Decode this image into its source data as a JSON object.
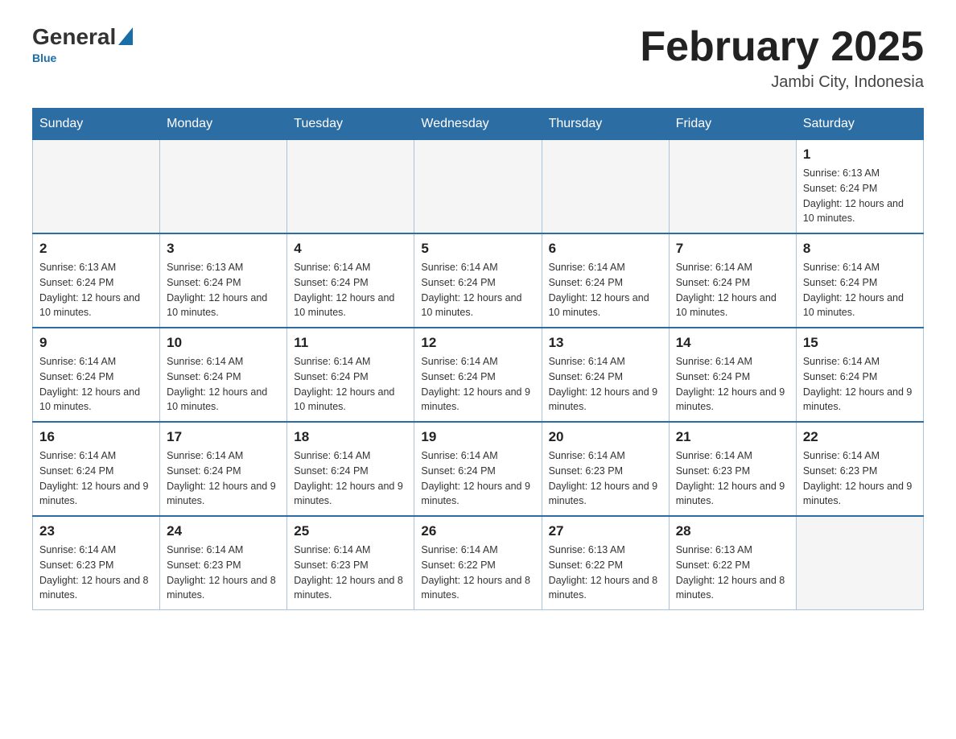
{
  "header": {
    "logo_general": "General",
    "logo_blue": "Blue",
    "title": "February 2025",
    "subtitle": "Jambi City, Indonesia"
  },
  "days_of_week": [
    "Sunday",
    "Monday",
    "Tuesday",
    "Wednesday",
    "Thursday",
    "Friday",
    "Saturday"
  ],
  "weeks": [
    [
      {
        "day": "",
        "empty": true
      },
      {
        "day": "",
        "empty": true
      },
      {
        "day": "",
        "empty": true
      },
      {
        "day": "",
        "empty": true
      },
      {
        "day": "",
        "empty": true
      },
      {
        "day": "",
        "empty": true
      },
      {
        "day": "1",
        "sunrise": "6:13 AM",
        "sunset": "6:24 PM",
        "daylight": "12 hours and 10 minutes."
      }
    ],
    [
      {
        "day": "2",
        "sunrise": "6:13 AM",
        "sunset": "6:24 PM",
        "daylight": "12 hours and 10 minutes."
      },
      {
        "day": "3",
        "sunrise": "6:13 AM",
        "sunset": "6:24 PM",
        "daylight": "12 hours and 10 minutes."
      },
      {
        "day": "4",
        "sunrise": "6:14 AM",
        "sunset": "6:24 PM",
        "daylight": "12 hours and 10 minutes."
      },
      {
        "day": "5",
        "sunrise": "6:14 AM",
        "sunset": "6:24 PM",
        "daylight": "12 hours and 10 minutes."
      },
      {
        "day": "6",
        "sunrise": "6:14 AM",
        "sunset": "6:24 PM",
        "daylight": "12 hours and 10 minutes."
      },
      {
        "day": "7",
        "sunrise": "6:14 AM",
        "sunset": "6:24 PM",
        "daylight": "12 hours and 10 minutes."
      },
      {
        "day": "8",
        "sunrise": "6:14 AM",
        "sunset": "6:24 PM",
        "daylight": "12 hours and 10 minutes."
      }
    ],
    [
      {
        "day": "9",
        "sunrise": "6:14 AM",
        "sunset": "6:24 PM",
        "daylight": "12 hours and 10 minutes."
      },
      {
        "day": "10",
        "sunrise": "6:14 AM",
        "sunset": "6:24 PM",
        "daylight": "12 hours and 10 minutes."
      },
      {
        "day": "11",
        "sunrise": "6:14 AM",
        "sunset": "6:24 PM",
        "daylight": "12 hours and 10 minutes."
      },
      {
        "day": "12",
        "sunrise": "6:14 AM",
        "sunset": "6:24 PM",
        "daylight": "12 hours and 9 minutes."
      },
      {
        "day": "13",
        "sunrise": "6:14 AM",
        "sunset": "6:24 PM",
        "daylight": "12 hours and 9 minutes."
      },
      {
        "day": "14",
        "sunrise": "6:14 AM",
        "sunset": "6:24 PM",
        "daylight": "12 hours and 9 minutes."
      },
      {
        "day": "15",
        "sunrise": "6:14 AM",
        "sunset": "6:24 PM",
        "daylight": "12 hours and 9 minutes."
      }
    ],
    [
      {
        "day": "16",
        "sunrise": "6:14 AM",
        "sunset": "6:24 PM",
        "daylight": "12 hours and 9 minutes."
      },
      {
        "day": "17",
        "sunrise": "6:14 AM",
        "sunset": "6:24 PM",
        "daylight": "12 hours and 9 minutes."
      },
      {
        "day": "18",
        "sunrise": "6:14 AM",
        "sunset": "6:24 PM",
        "daylight": "12 hours and 9 minutes."
      },
      {
        "day": "19",
        "sunrise": "6:14 AM",
        "sunset": "6:24 PM",
        "daylight": "12 hours and 9 minutes."
      },
      {
        "day": "20",
        "sunrise": "6:14 AM",
        "sunset": "6:23 PM",
        "daylight": "12 hours and 9 minutes."
      },
      {
        "day": "21",
        "sunrise": "6:14 AM",
        "sunset": "6:23 PM",
        "daylight": "12 hours and 9 minutes."
      },
      {
        "day": "22",
        "sunrise": "6:14 AM",
        "sunset": "6:23 PM",
        "daylight": "12 hours and 9 minutes."
      }
    ],
    [
      {
        "day": "23",
        "sunrise": "6:14 AM",
        "sunset": "6:23 PM",
        "daylight": "12 hours and 8 minutes."
      },
      {
        "day": "24",
        "sunrise": "6:14 AM",
        "sunset": "6:23 PM",
        "daylight": "12 hours and 8 minutes."
      },
      {
        "day": "25",
        "sunrise": "6:14 AM",
        "sunset": "6:23 PM",
        "daylight": "12 hours and 8 minutes."
      },
      {
        "day": "26",
        "sunrise": "6:14 AM",
        "sunset": "6:22 PM",
        "daylight": "12 hours and 8 minutes."
      },
      {
        "day": "27",
        "sunrise": "6:13 AM",
        "sunset": "6:22 PM",
        "daylight": "12 hours and 8 minutes."
      },
      {
        "day": "28",
        "sunrise": "6:13 AM",
        "sunset": "6:22 PM",
        "daylight": "12 hours and 8 minutes."
      },
      {
        "day": "",
        "empty": true
      }
    ]
  ],
  "labels": {
    "sunrise_label": "Sunrise:",
    "sunset_label": "Sunset:",
    "daylight_label": "Daylight:"
  }
}
